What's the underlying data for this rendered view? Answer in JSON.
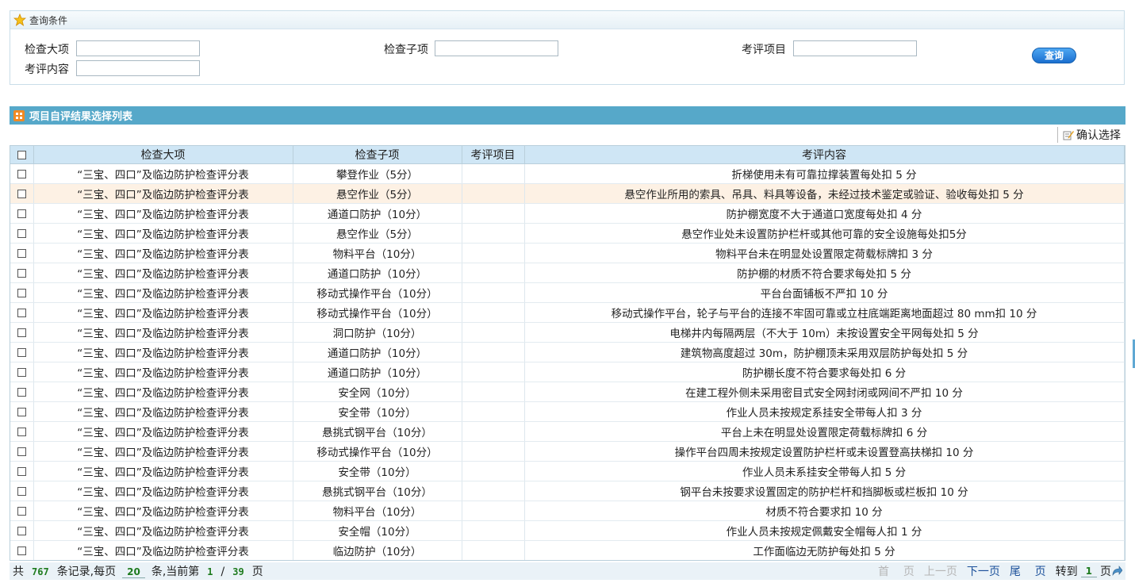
{
  "query": {
    "title": "查询条件",
    "labels": {
      "major": "检查大项",
      "sub": "检查子项",
      "project": "考评项目",
      "content": "考评内容"
    },
    "button": "查询"
  },
  "list": {
    "title": "项目自评结果选择列表",
    "confirm": "确认选择",
    "headers": [
      "检查大项",
      "检查子项",
      "考评项目",
      "考评内容"
    ],
    "rows": [
      [
        "“三宝、四口”及临边防护检查评分表",
        "攀登作业（5分）",
        "",
        "折梯使用未有可靠拉撑装置每处扣 5 分"
      ],
      [
        "“三宝、四口”及临边防护检查评分表",
        "悬空作业（5分）",
        "",
        "悬空作业所用的索具、吊具、料具等设备，未经过技术鉴定或验证、验收每处扣 5 分"
      ],
      [
        "“三宝、四口”及临边防护检查评分表",
        "通道口防护（10分）",
        "",
        "防护棚宽度不大于通道口宽度每处扣 4 分"
      ],
      [
        "“三宝、四口”及临边防护检查评分表",
        "悬空作业（5分）",
        "",
        "悬空作业处未设置防护栏杆或其他可靠的安全设施每处扣5分"
      ],
      [
        "“三宝、四口”及临边防护检查评分表",
        "物料平台（10分）",
        "",
        "物料平台未在明显处设置限定荷载标牌扣 3 分"
      ],
      [
        "“三宝、四口”及临边防护检查评分表",
        "通道口防护（10分）",
        "",
        "防护棚的材质不符合要求每处扣 5 分"
      ],
      [
        "“三宝、四口”及临边防护检查评分表",
        "移动式操作平台（10分）",
        "",
        "平台台面铺板不严扣 10 分"
      ],
      [
        "“三宝、四口”及临边防护检查评分表",
        "移动式操作平台（10分）",
        "",
        "移动式操作平台，轮子与平台的连接不牢固可靠或立柱底端距离地面超过 80 mm扣 10 分"
      ],
      [
        "“三宝、四口”及临边防护检查评分表",
        "洞口防护（10分）",
        "",
        "电梯井内每隔两层（不大于 10m）未按设置安全平网每处扣 5 分"
      ],
      [
        "“三宝、四口”及临边防护检查评分表",
        "通道口防护（10分）",
        "",
        "建筑物高度超过 30m，防护棚顶未采用双层防护每处扣 5 分"
      ],
      [
        "“三宝、四口”及临边防护检查评分表",
        "通道口防护（10分）",
        "",
        "防护棚长度不符合要求每处扣 6 分"
      ],
      [
        "“三宝、四口”及临边防护检查评分表",
        "安全网（10分）",
        "",
        "在建工程外侧未采用密目式安全网封闭或网间不严扣 10 分"
      ],
      [
        "“三宝、四口”及临边防护检查评分表",
        "安全带（10分）",
        "",
        "作业人员未按规定系挂安全带每人扣 3 分"
      ],
      [
        "“三宝、四口”及临边防护检查评分表",
        "悬挑式钢平台（10分）",
        "",
        "平台上未在明显处设置限定荷载标牌扣 6 分"
      ],
      [
        "“三宝、四口”及临边防护检查评分表",
        "移动式操作平台（10分）",
        "",
        "操作平台四周未按规定设置防护栏杆或未设置登高扶梯扣 10 分"
      ],
      [
        "“三宝、四口”及临边防护检查评分表",
        "安全带（10分）",
        "",
        "作业人员未系挂安全带每人扣 5 分"
      ],
      [
        "“三宝、四口”及临边防护检查评分表",
        "悬挑式钢平台（10分）",
        "",
        "钢平台未按要求设置固定的防护栏杆和挡脚板或栏板扣 10 分"
      ],
      [
        "“三宝、四口”及临边防护检查评分表",
        "物料平台（10分）",
        "",
        "材质不符合要求扣 10 分"
      ],
      [
        "“三宝、四口”及临边防护检查评分表",
        "安全帽（10分）",
        "",
        "作业人员未按规定佩戴安全帽每人扣 1 分"
      ],
      [
        "“三宝、四口”及临边防护检查评分表",
        "临边防护（10分）",
        "",
        "工作面临边无防护每处扣 5 分"
      ]
    ],
    "highlight_row": 1
  },
  "pager": {
    "t1": "共",
    "total": "767",
    "t2": "条记录,每页",
    "per_page": "20",
    "t3": "条,当前第",
    "current": "1",
    "sep": "/",
    "pages": "39",
    "t4": "页",
    "first": "首",
    "page_word": "页",
    "prev": "上一页",
    "next": "下一页",
    "last": "尾",
    "goto": "转到",
    "goto_page": "1",
    "goto_suffix": "页"
  },
  "colors": {
    "header_bar": "#56a8c9",
    "table_header": "#cfe6f5",
    "highlight_row": "#fdf1e4",
    "pager_number": "#1e7b1e"
  }
}
